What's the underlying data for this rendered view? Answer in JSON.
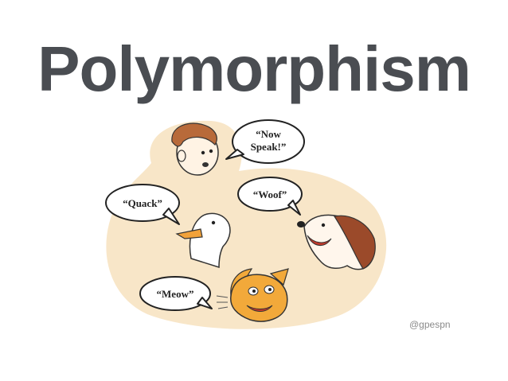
{
  "slide": {
    "title": "Polymorphism",
    "credit": "@gpespn"
  },
  "cartoon": {
    "bubbles": {
      "person_line1": "“Now",
      "person_line2": "Speak!”",
      "duck": "“Quack”",
      "dog": "“Woof”",
      "cat": "“Meow”"
    },
    "colors": {
      "background_blob": "#f8e6c8",
      "duck_beak": "#f2a23a",
      "dog_brown": "#9b4a2a",
      "cat_orange": "#f2a93a",
      "title": "#4a4d52"
    }
  }
}
